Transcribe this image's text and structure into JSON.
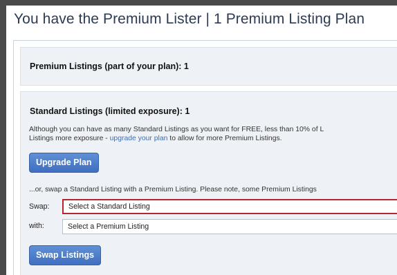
{
  "header": {
    "title": "You have the Premium Lister | 1 Premium Listing Plan"
  },
  "premium": {
    "title": "Premium Listings (part of your plan): 1"
  },
  "standard": {
    "title": "Standard Listings (limited exposure): 1",
    "description_line1": "Although you can have as many Standard Listings as you want for FREE, less than 10% of L",
    "description_line2_prefix": "Listings more exposure - ",
    "description_link": "upgrade your plan",
    "description_line2_suffix": " to allow for more Premium Listings.",
    "upgrade_button": "Upgrade Plan"
  },
  "swap": {
    "intro": "...or, swap a Standard Listing with a Premium Listing. Please note, some Premium Listings",
    "swap_label": "Swap:",
    "swap_select_value": "Select a Standard Listing",
    "with_label": "with:",
    "with_select_value": "Select a Premium Listing",
    "swap_button": "Swap Listings"
  },
  "colors": {
    "title_text": "#2b3a55",
    "button_blue": "#3f6fbf",
    "link_blue": "#3a6fb8",
    "highlight_red": "#b8242b",
    "section_bg": "#eef2f6"
  }
}
